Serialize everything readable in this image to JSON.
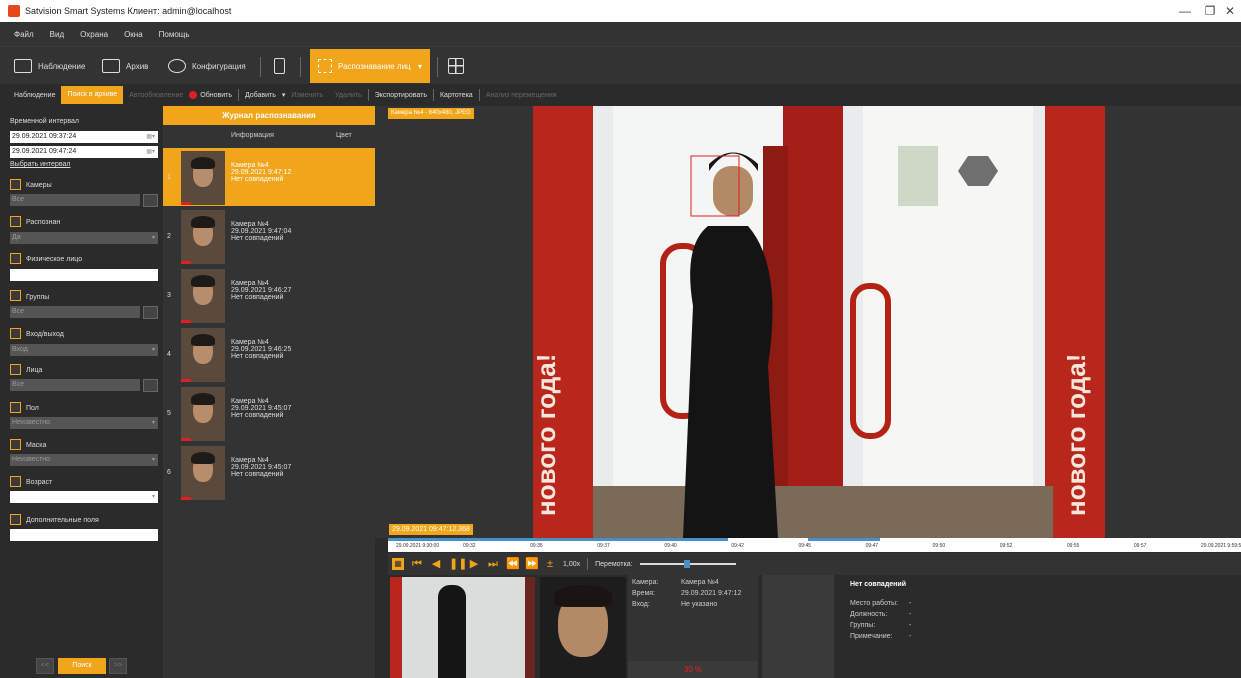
{
  "window": {
    "title": "Satvision Smart Systems Клиент: admin@localhost"
  },
  "menu": [
    "Файл",
    "Вид",
    "Охрана",
    "Окна",
    "Помощь"
  ],
  "toolbar": {
    "monitoring": "Наблюдение",
    "archive": "Архив",
    "configuration": "Конфигурация",
    "face_recognition": "Распознавание лиц"
  },
  "toolbar2": {
    "monitoring": "Наблюдение",
    "archive_search": "Поиск в архиве",
    "auto_refresh": "Автообновление",
    "refresh_badge": "2",
    "refresh": "Обновить",
    "add": "Добавить",
    "edit": "Изменить",
    "delete": "Удалить",
    "export": "Экспортировать",
    "cardfile": "Картотека",
    "movement_analysis": "Анализ перемещения"
  },
  "filters": {
    "time_interval_label": "Временной интервал",
    "time_from": "29.09.2021 09:37:24",
    "time_to": "29.09.2021 09:47:24",
    "select_interval": "Выбрать интервал",
    "cameras_label": "Камеры",
    "cameras_value": "Все",
    "recognized_label": "Распознан",
    "recognized_value": "Да",
    "physical_face_label": "Физическое лицо",
    "physical_face_value": "",
    "groups_label": "Группы",
    "groups_value": "Все",
    "entry_exit_label": "Вход/выход",
    "entry_exit_value": "Вход",
    "faces_label": "Лица",
    "faces_value": "Все",
    "gender_label": "Пол",
    "gender_value": "Неизвестно",
    "mask_label": "Маска",
    "mask_value": "Неизвестно",
    "age_label": "Возраст",
    "age_value": "",
    "extra_fields_label": "Дополнительные поля",
    "extra_fields_value": "",
    "prev": "<<",
    "search": "Поиск",
    "next": ">>"
  },
  "journal": {
    "title": "Журнал распознавания",
    "col_info": "Информация",
    "col_color": "Цвет",
    "rows": [
      {
        "num": "1",
        "camera": "Камера №4",
        "time": "29.09.2021 9:47:12",
        "status": "Нет совпадений"
      },
      {
        "num": "2",
        "camera": "Камера №4",
        "time": "29.09.2021 9:47:04",
        "status": "Нет совпадений"
      },
      {
        "num": "3",
        "camera": "Камера №4",
        "time": "29.09.2021 9:46:27",
        "status": "Нет совпадений"
      },
      {
        "num": "4",
        "camera": "Камера №4",
        "time": "29.09.2021 9:46:25",
        "status": "Нет совпадений"
      },
      {
        "num": "5",
        "camera": "Камера №4",
        "time": "29.09.2021 9:45:07",
        "status": "Нет совпадений"
      },
      {
        "num": "6",
        "camera": "Камера №4",
        "time": "29.09.2021 9:45:07",
        "status": "Нет совпадений"
      }
    ]
  },
  "video": {
    "camera_label": "Камера №4 - 640x480, JPEG",
    "timestamp": "29.09.2021 09:47:12.368",
    "sign_text": "нового года!"
  },
  "timeline": {
    "ticks": [
      "29.09.2021 9:30:00",
      "09:32",
      "09:35",
      "09:37",
      "09:40",
      "09:42",
      "09:45",
      "09:47",
      "09:50",
      "09:52",
      "09:55",
      "09:57",
      "29.09.2021 9:59:59"
    ]
  },
  "controls": {
    "speed": "1,00x",
    "rewind_label": "Перемотка:"
  },
  "details": {
    "camera_key": "Камера:",
    "camera_val": "Камера №4",
    "time_key": "Время:",
    "time_val": "29.09.2021 9:47:12",
    "entry_key": "Вход:",
    "entry_val": "Не указано",
    "match_percent": "30 %",
    "no_match_title": "Нет совпадений",
    "workplace_key": "Место работы:",
    "workplace_val": "-",
    "position_key": "Должность:",
    "position_val": "-",
    "groups_key": "Группы:",
    "groups_val": "-",
    "note_key": "Примечание:",
    "note_val": "-"
  }
}
